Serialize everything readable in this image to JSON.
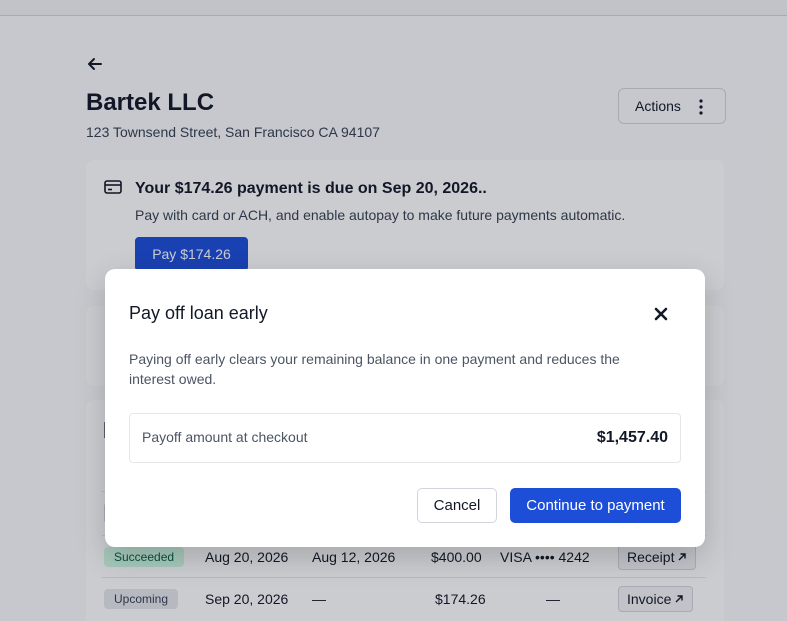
{
  "account": {
    "name": "Bartek LLC",
    "address": "123 Townsend Street, San Francisco CA 94107"
  },
  "header": {
    "actions_label": "Actions"
  },
  "due_card": {
    "title": "Your $174.26 payment is due on Sep 20, 2026..",
    "subtitle": "Pay with card or ACH, and enable autopay to make future payments automatic.",
    "pay_label": "Pay $174.26"
  },
  "payments": {
    "rows": [
      {
        "status": "Succeeded",
        "date": "Aug 20, 2026",
        "paid_on": "Aug 12, 2026",
        "amount": "$400.00",
        "method": "VISA •••• 4242",
        "doc_label": "Receipt"
      },
      {
        "status": "Upcoming",
        "date": "Sep 20, 2026",
        "paid_on": "—",
        "amount": "$174.26",
        "method": "—",
        "doc_label": "Invoice"
      }
    ]
  },
  "modal": {
    "title": "Pay off loan early",
    "description": "Paying off early clears your remaining balance in one payment and reduces the interest owed.",
    "payoff_label": "Payoff amount at checkout",
    "payoff_amount": "$1,457.40",
    "cancel_label": "Cancel",
    "continue_label": "Continue to payment"
  },
  "colors": {
    "primary": "#1d4ed8",
    "success_bg": "#d1fae5",
    "success_text": "#065f46",
    "neutral_bg": "#e5e7eb"
  }
}
